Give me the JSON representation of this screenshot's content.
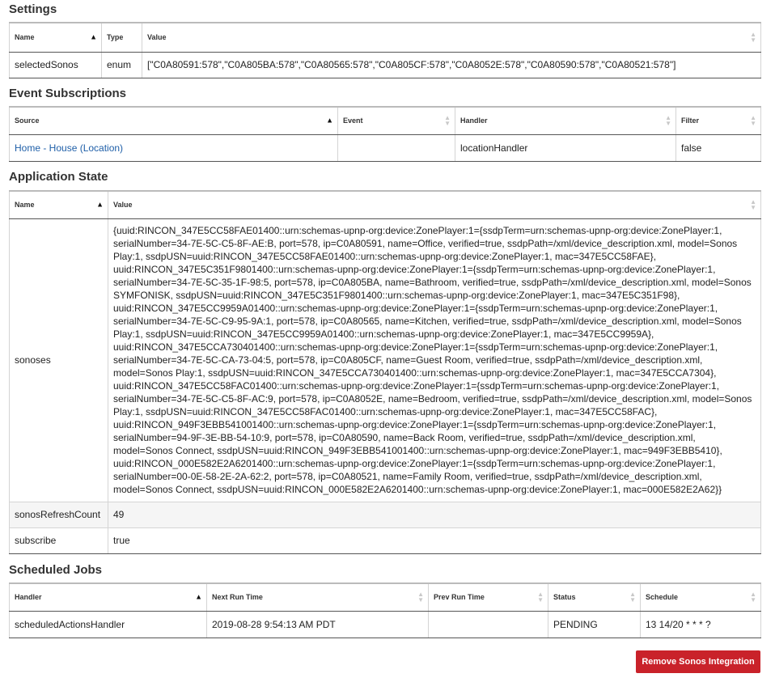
{
  "settings": {
    "title": "Settings",
    "headers": [
      "Name",
      "Type",
      "Value"
    ],
    "rows": [
      {
        "name": "selectedSonos",
        "type": "enum",
        "value": "[\"C0A80591:578\",\"C0A805BA:578\",\"C0A80565:578\",\"C0A805CF:578\",\"C0A8052E:578\",\"C0A80590:578\",\"C0A80521:578\"]"
      }
    ]
  },
  "event_subscriptions": {
    "title": "Event Subscriptions",
    "headers": [
      "Source",
      "Event",
      "Handler",
      "Filter"
    ],
    "rows": [
      {
        "source": "Home - House (Location)",
        "event": "",
        "handler": "locationHandler",
        "filter": "false"
      }
    ]
  },
  "application_state": {
    "title": "Application State",
    "headers": [
      "Name",
      "Value"
    ],
    "rows": [
      {
        "name": "sonoses",
        "value": "{uuid:RINCON_347E5CC58FAE01400::urn:schemas-upnp-org:device:ZonePlayer:1={ssdpTerm=urn:schemas-upnp-org:device:ZonePlayer:1, serialNumber=34-7E-5C-C5-8F-AE:B, port=578, ip=C0A80591, name=Office, verified=true, ssdpPath=/xml/device_description.xml, model=Sonos Play:1, ssdpUSN=uuid:RINCON_347E5CC58FAE01400::urn:schemas-upnp-org:device:ZonePlayer:1, mac=347E5CC58FAE}, uuid:RINCON_347E5C351F9801400::urn:schemas-upnp-org:device:ZonePlayer:1={ssdpTerm=urn:schemas-upnp-org:device:ZonePlayer:1, serialNumber=34-7E-5C-35-1F-98:5, port=578, ip=C0A805BA, name=Bathroom, verified=true, ssdpPath=/xml/device_description.xml, model=Sonos SYMFONISK, ssdpUSN=uuid:RINCON_347E5C351F9801400::urn:schemas-upnp-org:device:ZonePlayer:1, mac=347E5C351F98}, uuid:RINCON_347E5CC9959A01400::urn:schemas-upnp-org:device:ZonePlayer:1={ssdpTerm=urn:schemas-upnp-org:device:ZonePlayer:1, serialNumber=34-7E-5C-C9-95-9A:1, port=578, ip=C0A80565, name=Kitchen, verified=true, ssdpPath=/xml/device_description.xml, model=Sonos Play:1, ssdpUSN=uuid:RINCON_347E5CC9959A01400::urn:schemas-upnp-org:device:ZonePlayer:1, mac=347E5CC9959A}, uuid:RINCON_347E5CCA730401400::urn:schemas-upnp-org:device:ZonePlayer:1={ssdpTerm=urn:schemas-upnp-org:device:ZonePlayer:1, serialNumber=34-7E-5C-CA-73-04:5, port=578, ip=C0A805CF, name=Guest Room, verified=true, ssdpPath=/xml/device_description.xml, model=Sonos Play:1, ssdpUSN=uuid:RINCON_347E5CCA730401400::urn:schemas-upnp-org:device:ZonePlayer:1, mac=347E5CCA7304}, uuid:RINCON_347E5CC58FAC01400::urn:schemas-upnp-org:device:ZonePlayer:1={ssdpTerm=urn:schemas-upnp-org:device:ZonePlayer:1, serialNumber=34-7E-5C-C5-8F-AC:9, port=578, ip=C0A8052E, name=Bedroom, verified=true, ssdpPath=/xml/device_description.xml, model=Sonos Play:1, ssdpUSN=uuid:RINCON_347E5CC58FAC01400::urn:schemas-upnp-org:device:ZonePlayer:1, mac=347E5CC58FAC}, uuid:RINCON_949F3EBB541001400::urn:schemas-upnp-org:device:ZonePlayer:1={ssdpTerm=urn:schemas-upnp-org:device:ZonePlayer:1, serialNumber=94-9F-3E-BB-54-10:9, port=578, ip=C0A80590, name=Back Room, verified=true, ssdpPath=/xml/device_description.xml, model=Sonos Connect, ssdpUSN=uuid:RINCON_949F3EBB541001400::urn:schemas-upnp-org:device:ZonePlayer:1, mac=949F3EBB5410}, uuid:RINCON_000E582E2A6201400::urn:schemas-upnp-org:device:ZonePlayer:1={ssdpTerm=urn:schemas-upnp-org:device:ZonePlayer:1, serialNumber=00-0E-58-2E-2A-62:2, port=578, ip=C0A80521, name=Family Room, verified=true, ssdpPath=/xml/device_description.xml, model=Sonos Connect, ssdpUSN=uuid:RINCON_000E582E2A6201400::urn:schemas-upnp-org:device:ZonePlayer:1, mac=000E582E2A62}}"
      },
      {
        "name": "sonosRefreshCount",
        "value": "49"
      },
      {
        "name": "subscribe",
        "value": "true"
      }
    ]
  },
  "scheduled_jobs": {
    "title": "Scheduled Jobs",
    "headers": [
      "Handler",
      "Next Run Time",
      "Prev Run Time",
      "Status",
      "Schedule"
    ],
    "rows": [
      {
        "handler": "scheduledActionsHandler",
        "next_run": "2019-08-28 9:54:13 AM PDT",
        "prev_run": "",
        "status": "PENDING",
        "schedule": "13 14/20 * * * ?"
      }
    ]
  },
  "actions": {
    "remove_label": "Remove Sonos Integration"
  },
  "colors": {
    "danger": "#c9222a",
    "link": "#1f5fa8"
  },
  "icons": {
    "sort_active": "sort-asc-icon",
    "sort_inactive": "sort-both-icon"
  }
}
